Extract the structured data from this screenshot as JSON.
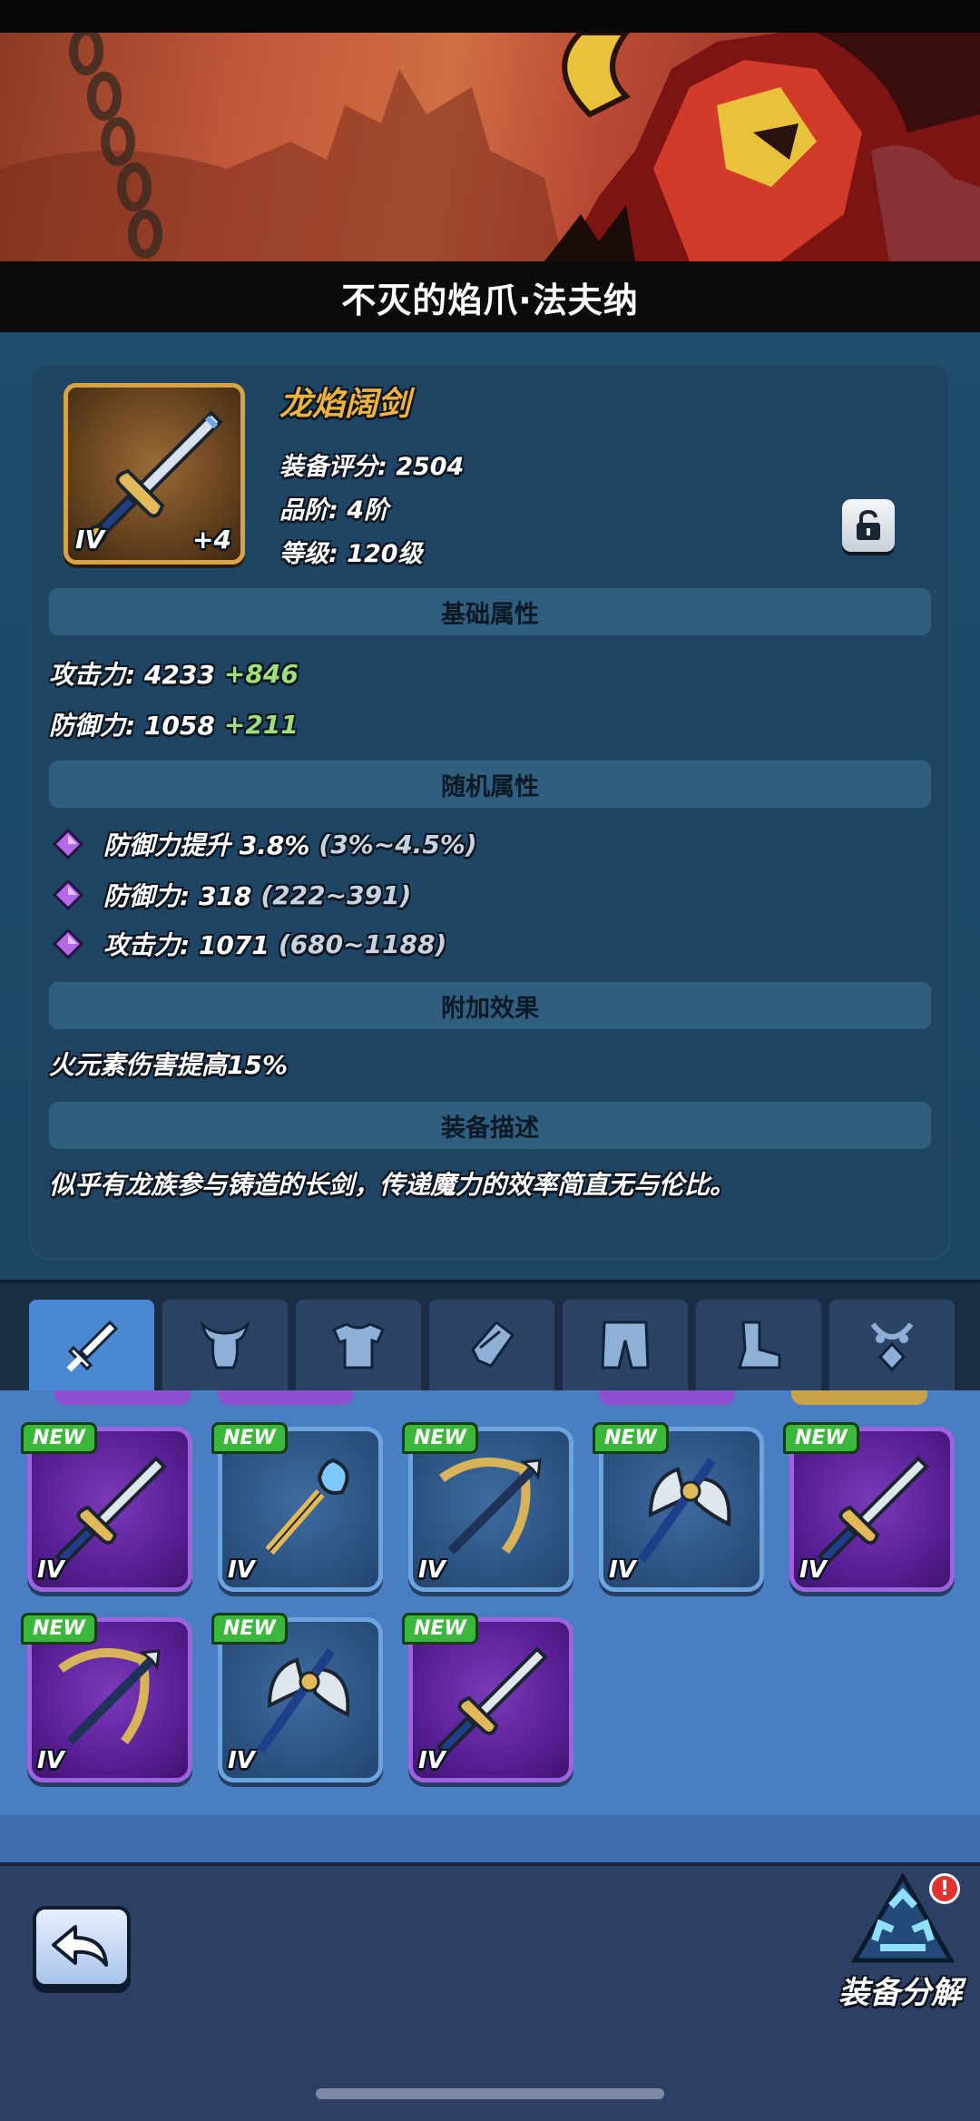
{
  "hero": {
    "name": "不灭的焰爪·法夫纳"
  },
  "item": {
    "name": "龙焰阔剑",
    "tier_badge": "IV",
    "enhance": "+4",
    "score_label": "装备评分: 2504",
    "grade_label": "品阶: 4阶",
    "level_label": "等级: 120级"
  },
  "sections": {
    "basic": "基础属性",
    "random": "随机属性",
    "extra": "附加效果",
    "desc": "装备描述"
  },
  "basic_attrs": [
    {
      "label": "攻击力: 4233",
      "bonus": "+846"
    },
    {
      "label": "防御力: 1058",
      "bonus": "+211"
    }
  ],
  "random_attrs": [
    {
      "label": "防御力提升 3.8%",
      "range": "(3%~4.5%)"
    },
    {
      "label": "防御力: 318",
      "range": "(222~391)"
    },
    {
      "label": "攻击力: 1071",
      "range": "(680~1188)"
    }
  ],
  "extra_effect": "火元素伤害提高15%",
  "description": "似乎有龙族参与铸造的长剑，传递魔力的效率简直无与伦比。",
  "tabs": [
    {
      "icon": "sword-icon",
      "active": true
    },
    {
      "icon": "helmet-icon",
      "active": false
    },
    {
      "icon": "armor-icon",
      "active": false
    },
    {
      "icon": "gauntlet-icon",
      "active": false
    },
    {
      "icon": "pants-icon",
      "active": false
    },
    {
      "icon": "boots-icon",
      "active": false
    },
    {
      "icon": "necklace-icon",
      "active": false
    }
  ],
  "inventory": {
    "new_label": "NEW",
    "tier_label": "IV",
    "items": [
      {
        "icon": "sword-icon",
        "rarity": "purple"
      },
      {
        "icon": "staff-icon",
        "rarity": "blue"
      },
      {
        "icon": "crossbow-icon",
        "rarity": "blue"
      },
      {
        "icon": "axe-icon",
        "rarity": "blue"
      },
      {
        "icon": "sword-icon",
        "rarity": "purple"
      },
      {
        "icon": "crossbow-icon",
        "rarity": "purple"
      },
      {
        "icon": "axe-icon",
        "rarity": "blue"
      },
      {
        "icon": "sword-icon",
        "rarity": "purple"
      }
    ]
  },
  "footer": {
    "decompose_label": "装备分解",
    "alert": "!"
  },
  "colors": {
    "gold": "#f0b33e",
    "bonus_green": "#9fe07a",
    "purple_frame": "#9e63e0",
    "blue_frame": "#6da4e0",
    "new_green": "#3bb83c"
  }
}
